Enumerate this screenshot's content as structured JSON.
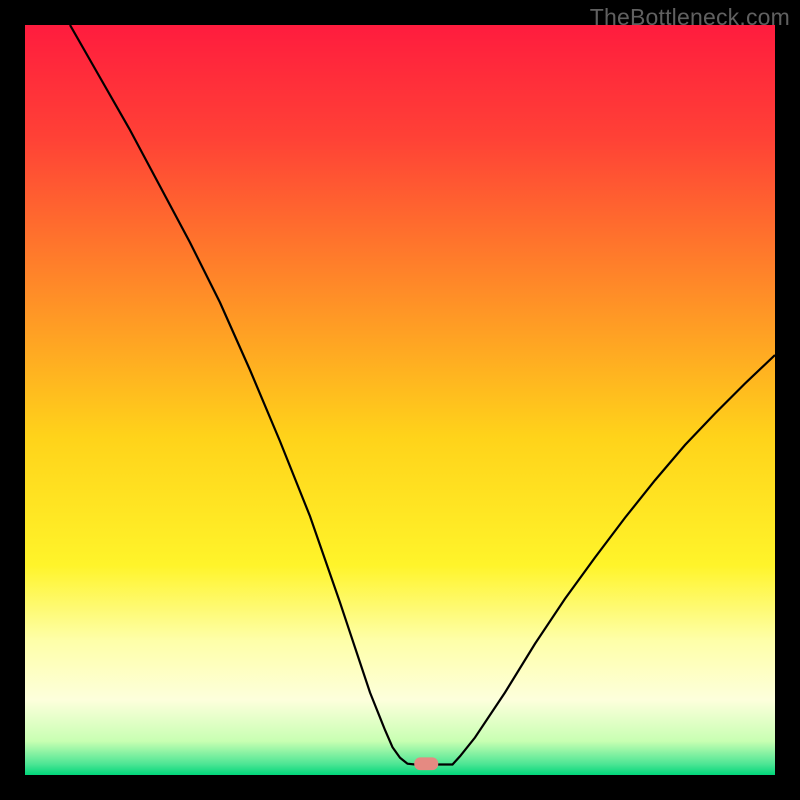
{
  "watermark": "TheBottleneck.com",
  "chart_data": {
    "type": "line",
    "title": "",
    "xlabel": "",
    "ylabel": "",
    "xlim": [
      0,
      100
    ],
    "ylim": [
      0,
      100
    ],
    "grid": false,
    "legend": false,
    "background_gradient": {
      "stops": [
        {
          "pos": 0.0,
          "color": "#ff1c3e"
        },
        {
          "pos": 0.15,
          "color": "#ff4136"
        },
        {
          "pos": 0.35,
          "color": "#ff8a28"
        },
        {
          "pos": 0.55,
          "color": "#ffd31a"
        },
        {
          "pos": 0.72,
          "color": "#fff42a"
        },
        {
          "pos": 0.82,
          "color": "#feffa8"
        },
        {
          "pos": 0.9,
          "color": "#fdffdc"
        },
        {
          "pos": 0.955,
          "color": "#c8ffb2"
        },
        {
          "pos": 0.985,
          "color": "#4fe695"
        },
        {
          "pos": 1.0,
          "color": "#00d67a"
        }
      ]
    },
    "series": [
      {
        "name": "bottleneck-curve",
        "color": "#000000",
        "width": 2.2,
        "x": [
          6,
          10,
          14,
          18,
          22,
          26,
          30,
          34,
          38,
          42,
          44,
          46,
          48,
          49,
          50,
          51,
          52,
          53.5,
          53.5,
          57,
          58,
          60,
          64,
          68,
          72,
          76,
          80,
          84,
          88,
          92,
          96,
          100
        ],
        "y": [
          100,
          93,
          86,
          78.5,
          71,
          63,
          54,
          44.5,
          34.5,
          23,
          17,
          11,
          6,
          3.7,
          2.3,
          1.5,
          1.4,
          1.4,
          1.4,
          1.4,
          2.5,
          5,
          11,
          17.5,
          23.5,
          29,
          34.3,
          39.3,
          44,
          48.2,
          52.2,
          56
        ]
      }
    ],
    "marker": {
      "present": true,
      "shape": "pill",
      "color": "#e58a82",
      "x": 53.5,
      "y": 1.5,
      "w": 3.2,
      "h": 1.7
    }
  }
}
